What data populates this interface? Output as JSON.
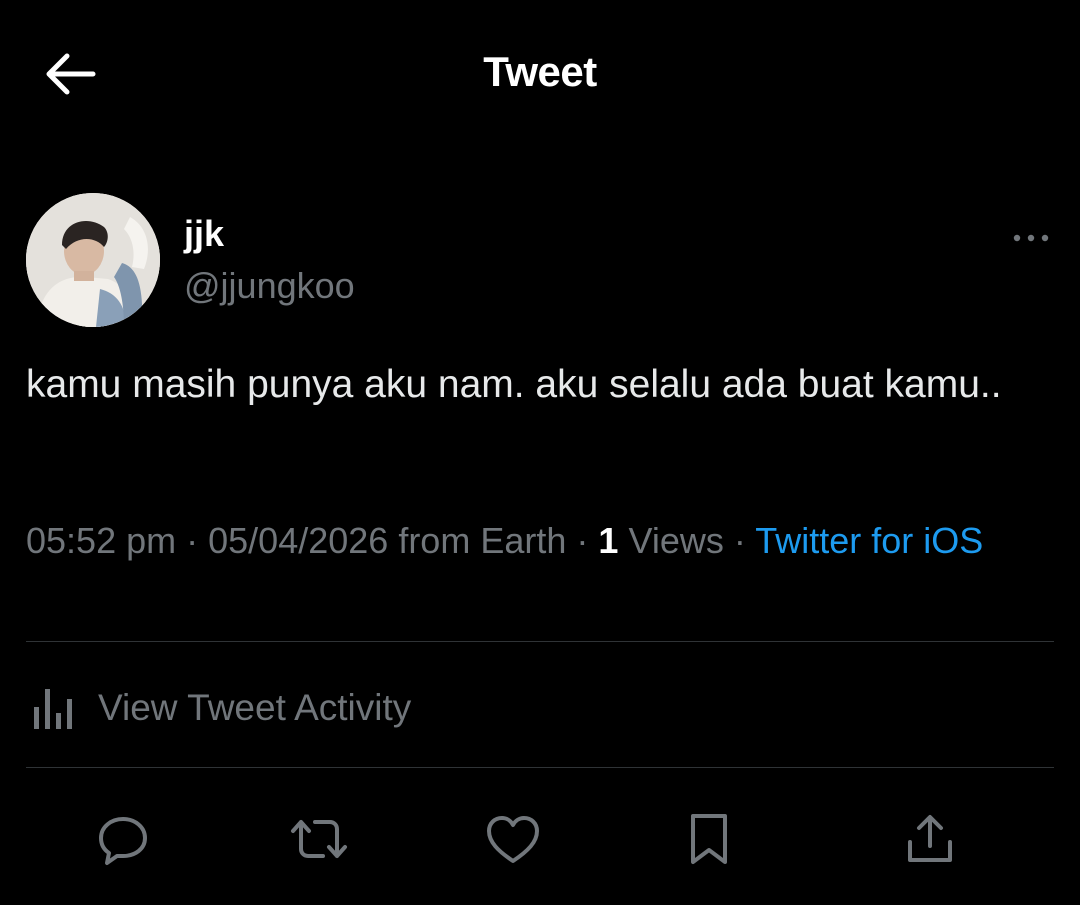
{
  "header": {
    "title": "Tweet",
    "back_icon": "arrow-left-icon"
  },
  "author": {
    "display_name": "jjk",
    "handle": "@jjungkoo",
    "more_icon": "more-horizontal-icon"
  },
  "tweet": {
    "text": "kamu masih punya aku nam. aku selalu ada buat kamu.."
  },
  "meta": {
    "time": "05:52 pm",
    "separator": "·",
    "date": "05/04/2026 from Earth",
    "views_count": "1",
    "views_label": "Views",
    "source": "Twitter for iOS"
  },
  "activity": {
    "label": "View Tweet Activity",
    "icon": "analytics-icon"
  },
  "actions": [
    {
      "name": "reply",
      "icon": "reply-icon"
    },
    {
      "name": "retweet",
      "icon": "retweet-icon"
    },
    {
      "name": "like",
      "icon": "heart-icon"
    },
    {
      "name": "bookmark",
      "icon": "bookmark-icon"
    },
    {
      "name": "share",
      "icon": "share-icon"
    }
  ],
  "colors": {
    "background": "#000000",
    "text": "#e7e9ea",
    "secondary": "#71767b",
    "link": "#1d9bf0",
    "divider": "#2f3336"
  }
}
